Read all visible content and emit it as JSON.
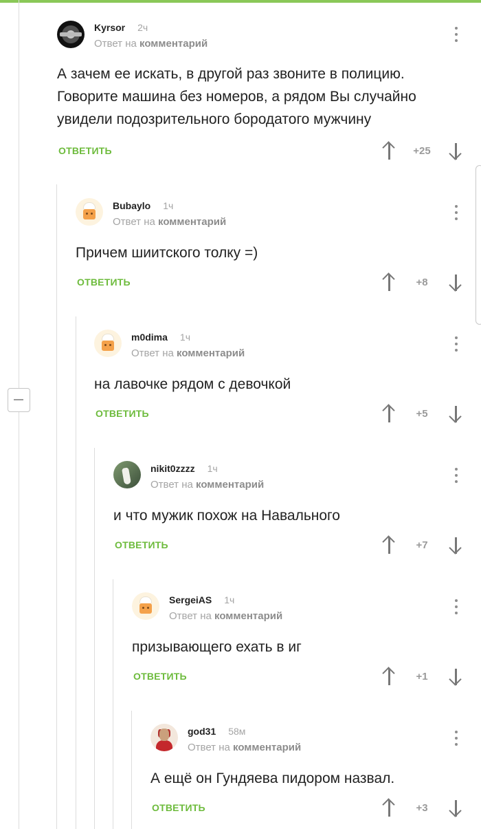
{
  "comments": [
    {
      "username": "Kyrsor",
      "time": "2ч",
      "reply_prefix": "Ответ на",
      "reply_target": "комментарий",
      "text_lines": [
        "А зачем ее искать, в другой раз звоните в полицию.",
        "Говорите машина без номеров, а рядом Вы случайно",
        "увидели подозрительного бородатого мужчину"
      ],
      "reply_label": "ОТВЕТИТЬ",
      "score": "+25",
      "avatar": "dark-logo-avatar"
    },
    {
      "username": "Bubaylo",
      "time": "1ч",
      "reply_prefix": "Ответ на",
      "reply_target": "комментарий",
      "text_lines": [
        "Причем шиитского толку =)"
      ],
      "reply_label": "ОТВЕТИТЬ",
      "score": "+8",
      "avatar": "default-avatar"
    },
    {
      "username": "m0dima",
      "time": "1ч",
      "reply_prefix": "Ответ на",
      "reply_target": "комментарий",
      "text_lines": [
        "на лавочке рядом с девочкой"
      ],
      "reply_label": "ОТВЕТИТЬ",
      "score": "+5",
      "avatar": "default-avatar"
    },
    {
      "username": "nikit0zzzz",
      "time": "1ч",
      "reply_prefix": "Ответ на",
      "reply_target": "комментарий",
      "text_lines": [
        "и что мужик похож на Навального"
      ],
      "reply_label": "ОТВЕТИТЬ",
      "score": "+7",
      "avatar": "goose-avatar"
    },
    {
      "username": "SergeiAS",
      "time": "1ч",
      "reply_prefix": "Ответ на",
      "reply_target": "комментарий",
      "text_lines": [
        "призывающего ехать в иг"
      ],
      "reply_label": "ОТВЕТИТЬ",
      "score": "+1",
      "avatar": "default-avatar"
    },
    {
      "username": "god31",
      "time": "58м",
      "reply_prefix": "Ответ на",
      "reply_target": "комментарий",
      "text_lines": [
        "А ещё он Гундяева пидором назвал."
      ],
      "reply_label": "ОТВЕТИТЬ",
      "score": "+3",
      "avatar": "red-shirt-avatar"
    }
  ],
  "colors": {
    "accent_green": "#6dbb3c",
    "top_bar_green": "#8ac858",
    "muted_text": "#a4a4a4"
  },
  "icons": [
    "vote-up-arrow-icon",
    "vote-down-arrow-icon",
    "more-options-icon",
    "collapse-thread-icon"
  ]
}
